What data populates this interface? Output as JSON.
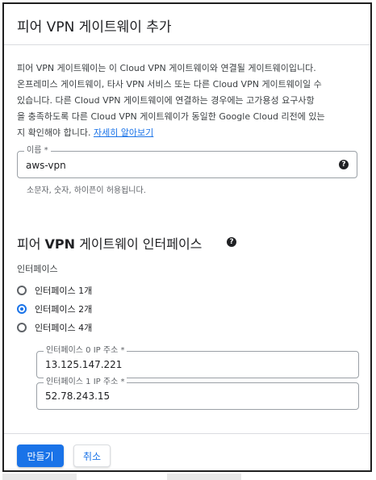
{
  "dialog": {
    "title": "피어 VPN 게이트웨이 추가",
    "description_lines": [
      "피어 VPN 게이트웨이는 이 Cloud VPN 게이트웨이와 연결될 게이트웨이입니다.",
      "온프레미스 게이트웨이, 타사 VPN 서비스 또는 다른 Cloud VPN 게이트웨이일 수",
      "있습니다. 다른 Cloud VPN 게이트웨이에 연결하는 경우에는 고가용성 요구사항",
      "을 충족하도록 다른 Cloud VPN 게이트웨이가 동일한 Google Cloud 리전에 있는"
    ],
    "description_last_prefix": "지 확인해야 합니다. ",
    "learn_more_link": "자세히 알아보기"
  },
  "name_field": {
    "label": "이름 *",
    "value": "aws-vpn",
    "hint": "소문자, 숫자, 하이픈이 허용됩니다."
  },
  "interfaces_section": {
    "title_prefix": "피어 ",
    "title_bold": "VPN",
    "title_suffix": " 게이트웨이 인터페이스",
    "label": "인터페이스",
    "options": [
      {
        "label": "인터페이스 1개",
        "checked": false
      },
      {
        "label": "인터페이스 2개",
        "checked": true
      },
      {
        "label": "인터페이스 4개",
        "checked": false
      }
    ],
    "ip_fields": [
      {
        "label": "인터페이스 0 IP 주소 *",
        "value": "13.125.147.221"
      },
      {
        "label": "인터페이스 1 IP 주소 *",
        "value": "52.78.243.15"
      }
    ]
  },
  "buttons": {
    "create": "만들기",
    "cancel": "취소"
  },
  "colors": {
    "accent": "#1a73e8",
    "text": "#202124",
    "border": "#9aa0a6"
  },
  "icons": {
    "help": "help-circle-icon"
  }
}
